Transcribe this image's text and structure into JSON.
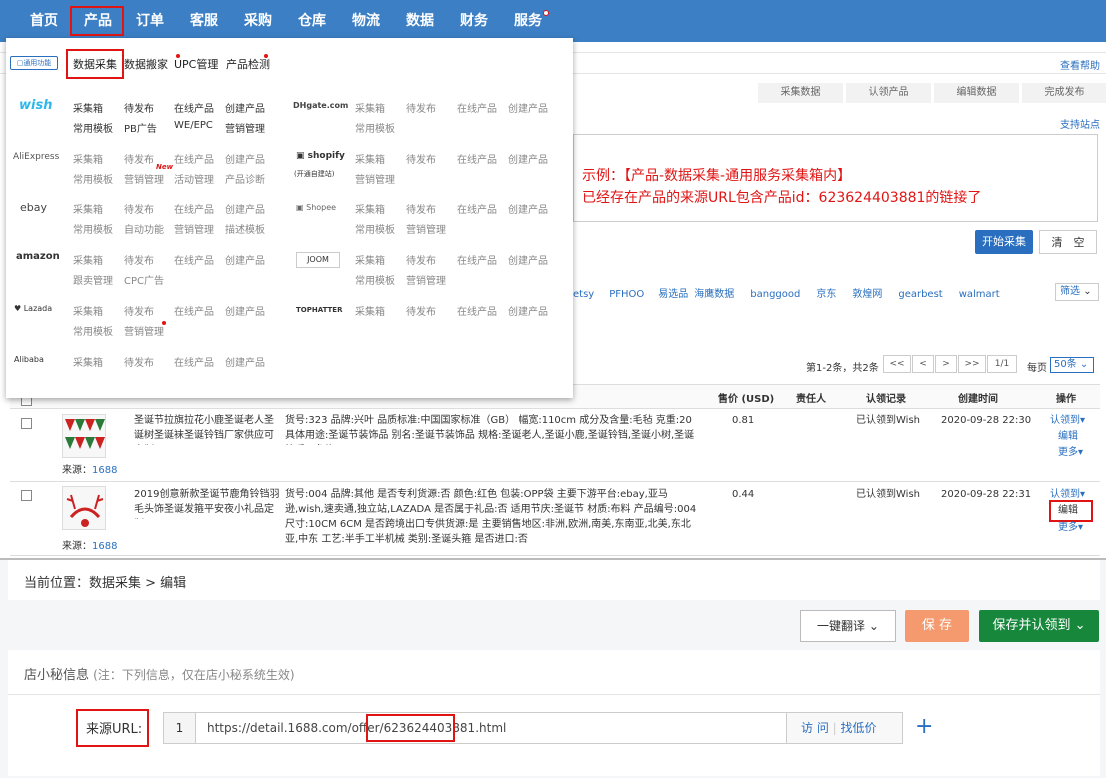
{
  "nav": {
    "items": [
      "首页",
      "产品",
      "订单",
      "客服",
      "采购",
      "仓库",
      "物流",
      "数据",
      "财务",
      "服务"
    ]
  },
  "menu": {
    "general_label": "通用功能",
    "sub_items": [
      "数据采集",
      "数据搬家",
      "UPC管理",
      "产品检测"
    ],
    "platforms": {
      "wish": {
        "name": "wish",
        "links": [
          "采集箱",
          "待发布",
          "在线产品",
          "创建产品",
          "常用模板",
          "PB广告",
          "WE/EPC",
          "营销管理"
        ]
      },
      "dhgate": {
        "name": "DHgate.com",
        "links": [
          "采集箱",
          "待发布",
          "在线产品",
          "创建产品",
          "常用模板"
        ]
      },
      "aliexpress": {
        "name": "AliExpress",
        "links": [
          "采集箱",
          "待发布",
          "在线产品",
          "创建产品",
          "常用模板",
          "营销管理",
          "活动管理",
          "产品诊断"
        ],
        "new_badge": "New"
      },
      "shopify": {
        "name": "shopify",
        "caption": "(开通自建站)",
        "links": [
          "采集箱",
          "待发布",
          "在线产品",
          "创建产品",
          "营销管理"
        ]
      },
      "ebay": {
        "name": "ebay",
        "links": [
          "采集箱",
          "待发布",
          "在线产品",
          "创建产品",
          "常用模板",
          "自动功能",
          "营销管理",
          "描述模板"
        ]
      },
      "shopee": {
        "name": "Shopee",
        "links": [
          "采集箱",
          "待发布",
          "在线产品",
          "创建产品",
          "常用模板",
          "营销管理"
        ]
      },
      "amazon": {
        "name": "amazon",
        "links": [
          "采集箱",
          "待发布",
          "在线产品",
          "创建产品",
          "跟卖管理",
          "CPC广告"
        ]
      },
      "joom": {
        "name": "JOOM",
        "links": [
          "采集箱",
          "待发布",
          "在线产品",
          "创建产品",
          "常用模板",
          "营销管理"
        ]
      },
      "lazada": {
        "name": "Lazada",
        "links": [
          "采集箱",
          "待发布",
          "在线产品",
          "创建产品",
          "常用模板",
          "营销管理"
        ]
      },
      "tophatter": {
        "name": "TOPHATTER",
        "links": [
          "采集箱",
          "待发布",
          "在线产品",
          "创建产品"
        ]
      },
      "alibaba": {
        "name": "Alibaba",
        "links": [
          "采集箱",
          "待发布",
          "在线产品",
          "创建产品"
        ]
      }
    }
  },
  "right": {
    "help": "查看帮助",
    "steps": [
      "采集数据",
      "认领产品",
      "编辑数据",
      "完成发布"
    ],
    "support": "支持站点",
    "annotation_line1": "示例：【产品-数据采集-通用服务采集箱内】",
    "annotation_line2": "已经存在产品的来源URL包含产品id：623624403881的链接了",
    "start_btn": "开始采集",
    "clear_btn": "清　空",
    "sources": [
      "etsy",
      "PFHOO",
      "易选品",
      "海鹰数据",
      "banggood",
      "京东",
      "敦煌网",
      "gearbest",
      "walmart"
    ],
    "filter": "筛选",
    "pager_text": "第1-2条，共2条",
    "pager_buttons": [
      "<<",
      "<",
      ">",
      ">>"
    ],
    "page_info": "1/1",
    "per_page_label": "每页",
    "per_page": "50条"
  },
  "table": {
    "headers": [
      "售价 (USD)",
      "责任人",
      "认领记录",
      "创建时间",
      "操作"
    ],
    "rows": [
      {
        "title": "圣诞节拉旗拉花小鹿圣诞老人圣诞树圣诞袜圣诞铃铛厂家供应可定制",
        "source_label": "来源：",
        "source": "1688",
        "desc": "货号:323 品牌:兴叶 品质标准:中国国家标准（GB） 幅宽:110cm 成分及含量:毛毡 克重:20 具体用途:圣诞节装饰品 别名:圣诞节装饰品 规格:圣诞老人,圣诞小鹿,圣诞铃铛,圣诞小树,圣诞快乐三角旗",
        "price": "0.81",
        "claim": "已认领到Wish",
        "time": "2020-09-28 22:30",
        "ops": [
          "认领到",
          "编辑",
          "更多"
        ]
      },
      {
        "title": "2019创意新款圣诞节鹿角铃铛羽毛头饰圣诞发箍平安夜小礼品定制",
        "source_label": "来源：",
        "source": "1688",
        "desc": "货号:004 品牌:其他 是否专利货源:否 颜色:红色 包装:OPP袋 主要下游平台:ebay,亚马逊,wish,速卖通,独立站,LAZADA 是否属于礼品:否 适用节庆:圣诞节 材质:布料 产品编号:004 尺寸:10CM 6CM 是否跨境出口专供货源:是 主要销售地区:非洲,欧洲,南美,东南亚,北美,东北亚,中东 工艺:半手工半机械 类别:圣诞头箍 是否进口:否",
        "price": "0.44",
        "claim": "已认领到Wish",
        "time": "2020-09-28 22:31",
        "ops": [
          "认领到",
          "编辑",
          "更多"
        ]
      }
    ]
  },
  "editor": {
    "breadcrumb": "当前位置：数据采集 > 编辑",
    "translate_btn": "一键翻译",
    "save_btn": "保 存",
    "save_claim_btn": "保存并认领到",
    "section_title": "店小秘信息",
    "section_note": "(注：下列信息，仅在店小秘系统生效)",
    "url_label": "来源URL:",
    "url_index": "1",
    "url_prefix": "https://detail.1688.com/offer/",
    "url_id": "623624403881",
    "url_suffix": ".html",
    "visit": "访 问",
    "find_low": "找低价",
    "add": "+"
  },
  "colors": {
    "nav": "#3d7fc5",
    "accent": "#2a6fbf",
    "highlight": "#e11414",
    "save": "#f59a6e",
    "save_claim": "#16873b"
  }
}
